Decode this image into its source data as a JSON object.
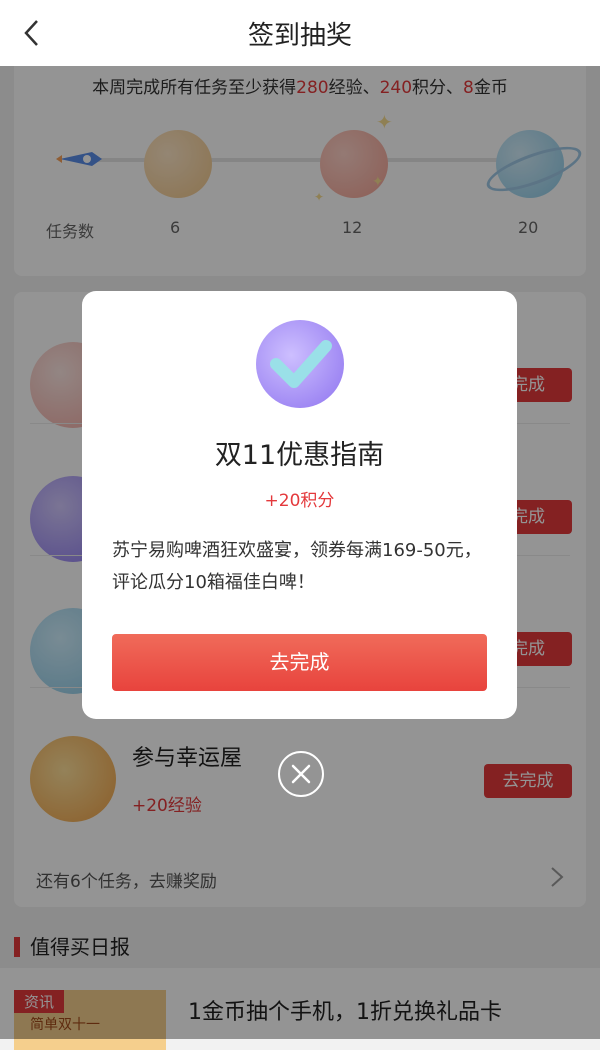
{
  "header": {
    "title": "签到抽奖"
  },
  "weekly": {
    "summary_prefix": "本周完成所有任务至少获得",
    "exp": "280",
    "exp_unit": "经验、",
    "points": "240",
    "points_unit": "积分、",
    "coins": "8",
    "coins_unit": "金币",
    "tick_label": "任务数",
    "milestones": [
      "6",
      "12",
      "20"
    ]
  },
  "tasks": [
    {
      "title": "",
      "reward": "",
      "button": "完成"
    },
    {
      "title": "",
      "reward": "",
      "button": "完成"
    },
    {
      "title": "",
      "reward": "",
      "button": "完成"
    },
    {
      "title": "参与幸运屋",
      "reward": "+20经验",
      "button": "去完成"
    }
  ],
  "more_tasks": "还有6个任务，去赚奖励",
  "daily": {
    "heading": "值得买日报",
    "article": {
      "badge": "资讯",
      "thumb_text": "简单双十一",
      "title": "1金币抽个手机，1折兑换礼品卡"
    }
  },
  "modal": {
    "title": "双11优惠指南",
    "reward": "+20积分",
    "description": "苏宁易购啤酒狂欢盛宴，领券每满169-50元，评论瓜分10箱福佳白啤！",
    "button": "去完成"
  },
  "colors": {
    "accent": "#e4393c",
    "button_gradient_top": "#f06b5a",
    "button_gradient_bottom": "#e8433d"
  },
  "icons": [
    "back-icon",
    "rocket-icon",
    "planet-icon",
    "chevron-right-icon",
    "check-icon",
    "close-icon"
  ]
}
